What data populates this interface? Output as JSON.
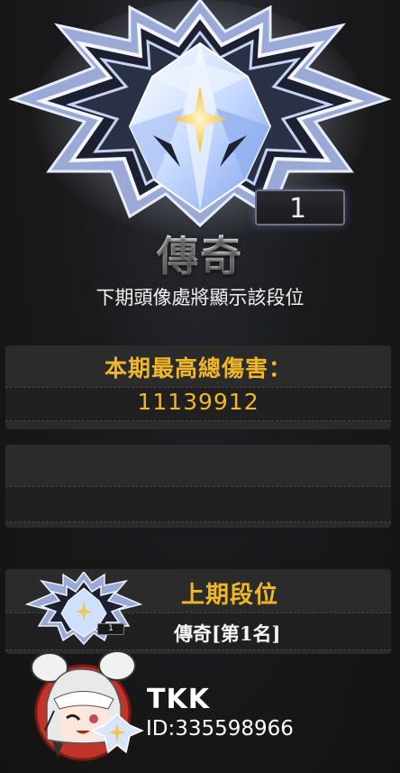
{
  "rank": {
    "number": "1",
    "tier_title": "傳奇",
    "subtitle": "下期頭像處將顯示該段位"
  },
  "damage_panel": {
    "label": "本期最高總傷害：",
    "value": "11139912"
  },
  "last_season_panel": {
    "label": "上期段位",
    "value": "傳奇[第1名]",
    "small_rank": "1"
  },
  "player": {
    "name": "TKK",
    "id_text": "ID:335598966"
  },
  "colors": {
    "accent_gold": "#f1b727",
    "background": "#151515",
    "panel": "#2b2b2b"
  },
  "icons": [
    "legend-tier-emblem-icon",
    "small-tier-emblem-icon",
    "player-avatar",
    "avatar-tier-crystal-icon"
  ]
}
